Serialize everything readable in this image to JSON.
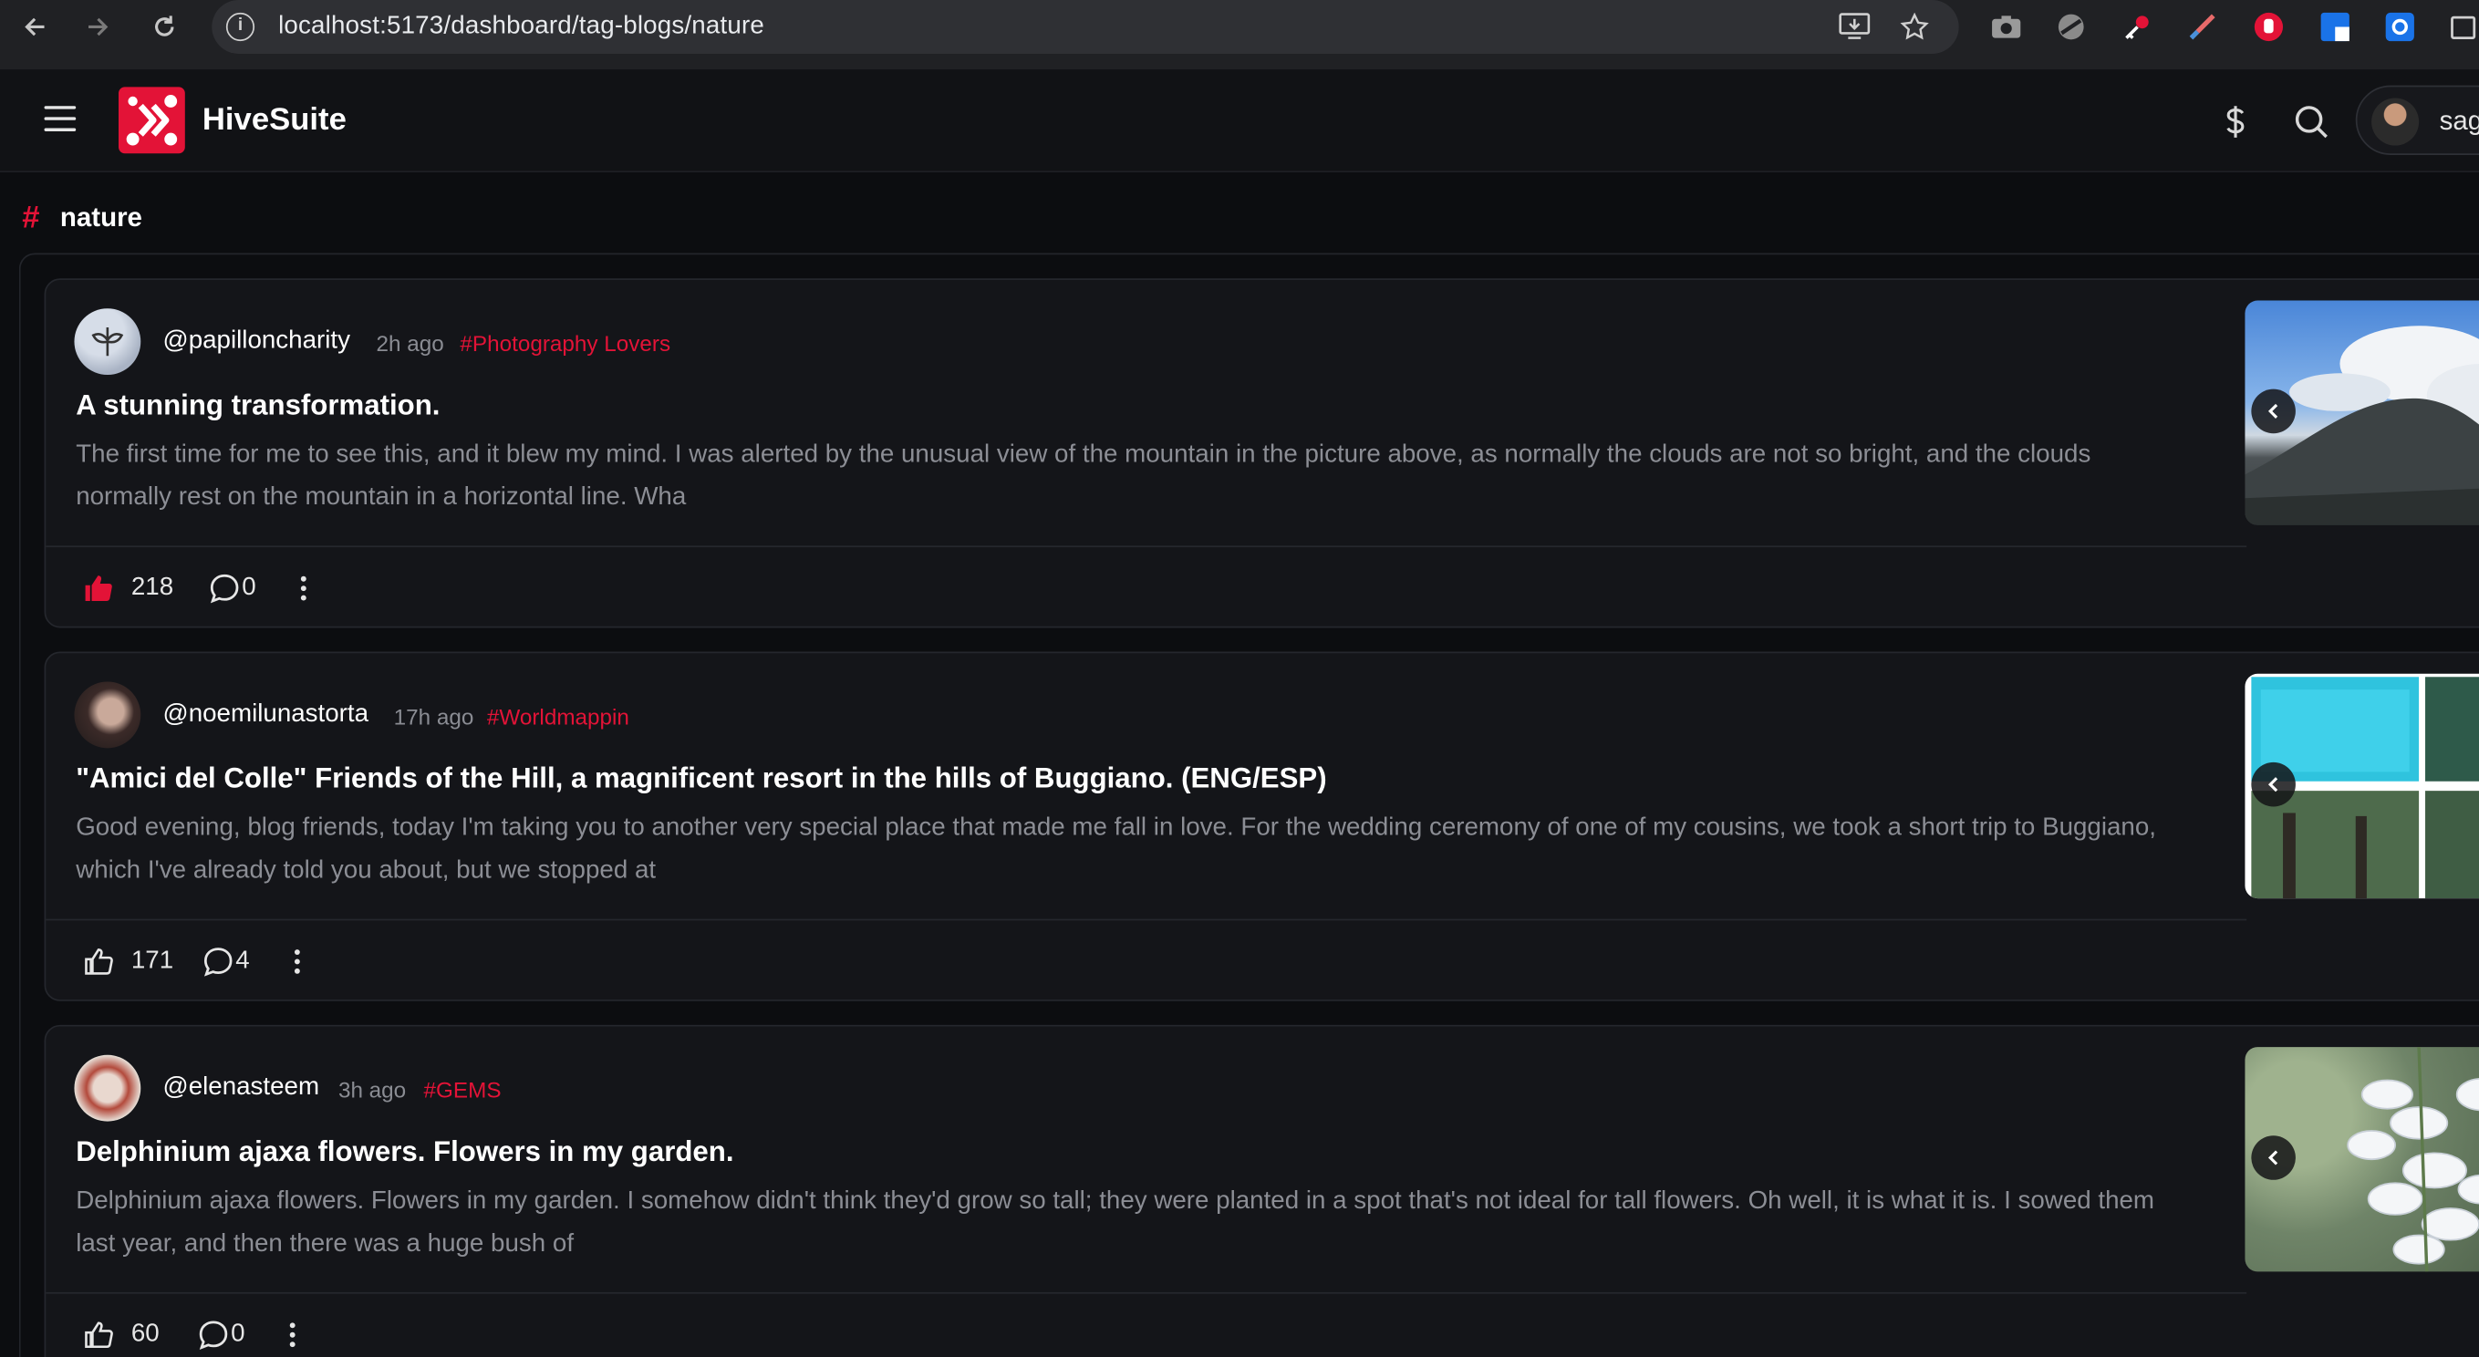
{
  "browser": {
    "url": "localhost:5173/dashboard/tag-blogs/nature"
  },
  "header": {
    "brand": "HiveSuite",
    "user_name": "sag"
  },
  "tag": {
    "name": "nature"
  },
  "posts": [
    {
      "author": "@papilloncharity",
      "time": "2h ago",
      "community": "#Photography Lovers",
      "title": "A stunning transformation.",
      "excerpt": "The first time for me to see this, and it blew my mind. I was alerted by the unusual view of the mountain in the picture above, as normally the clouds are not so bright, and the clouds normally rest on the mountain in a horizontal line. Wha",
      "votes": "218",
      "comments": "0",
      "voted": true
    },
    {
      "author": "@noemilunastorta",
      "time": "17h ago",
      "community": "#Worldmappin",
      "title": "\"Amici del Colle\" Friends of the Hill, a magnificent resort in the hills of Buggiano. (ENG/ESP)",
      "excerpt": "Good evening, blog friends, today I'm taking you to another very special place that made me fall in love. For the wedding ceremony of one of my cousins, we took a short trip to Buggiano, which I've already told you about, but we stopped at",
      "votes": "171",
      "comments": "4",
      "voted": false
    },
    {
      "author": "@elenasteem",
      "time": "3h ago",
      "community": "#GEMS",
      "title": "Delphinium ajaxa flowers. Flowers in my garden.",
      "excerpt": "Delphinium ajaxa flowers. Flowers in my garden. I somehow didn't think they'd grow so tall; they were planted in a spot that's not ideal for tall flowers. Oh well, it is what it is. I sowed them last year, and then there was a huge bush of",
      "votes": "60",
      "comments": "0",
      "voted": false
    }
  ],
  "colors": {
    "accent": "#e31337",
    "background": "#0c0d10",
    "card": "#141519",
    "muted_text": "#8c8e95"
  }
}
